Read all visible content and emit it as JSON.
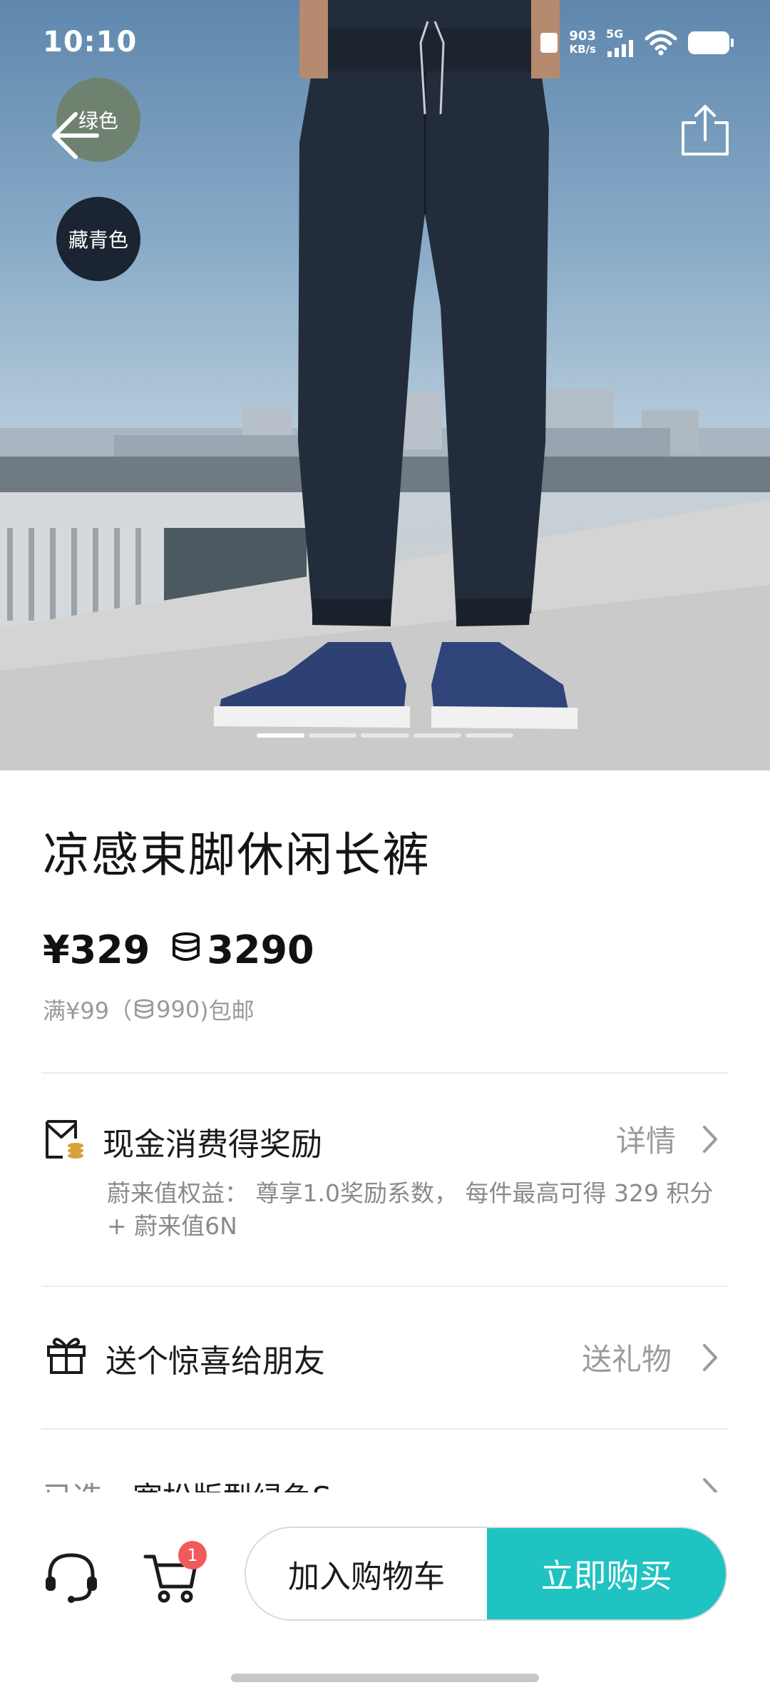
{
  "status_bar": {
    "time": "10:10",
    "net_speed_value": "903",
    "net_speed_unit": "KB/s",
    "network": "5G"
  },
  "gallery": {
    "colors": [
      {
        "label": "绿色",
        "swatch": "#6f8270"
      },
      {
        "label": "藏青色",
        "swatch": "#1b2433"
      }
    ]
  },
  "product": {
    "title": "凉感束脚休闲长裤",
    "price": "¥329",
    "points_price": "3290",
    "shipping_prefix": "满¥99（",
    "shipping_points": "990",
    "shipping_suffix": ")包邮"
  },
  "reward": {
    "title": "现金消费得奖励",
    "link": "详情",
    "description": "蔚来值权益： 尊享1.0奖励系数， 每件最高可得 329 积分 + 蔚来值6N"
  },
  "gift": {
    "title": "送个惊喜给朋友",
    "link": "送礼物"
  },
  "selected": {
    "label": "已选",
    "value": "宽松版型绿色S"
  },
  "bottom_bar": {
    "cart_badge": "1",
    "add_to_cart": "加入购物车",
    "buy_now": "立即购买"
  },
  "colors": {
    "accent": "#1fc3c1",
    "badge": "#f05a5a",
    "muted_text": "#9a9a9a"
  }
}
